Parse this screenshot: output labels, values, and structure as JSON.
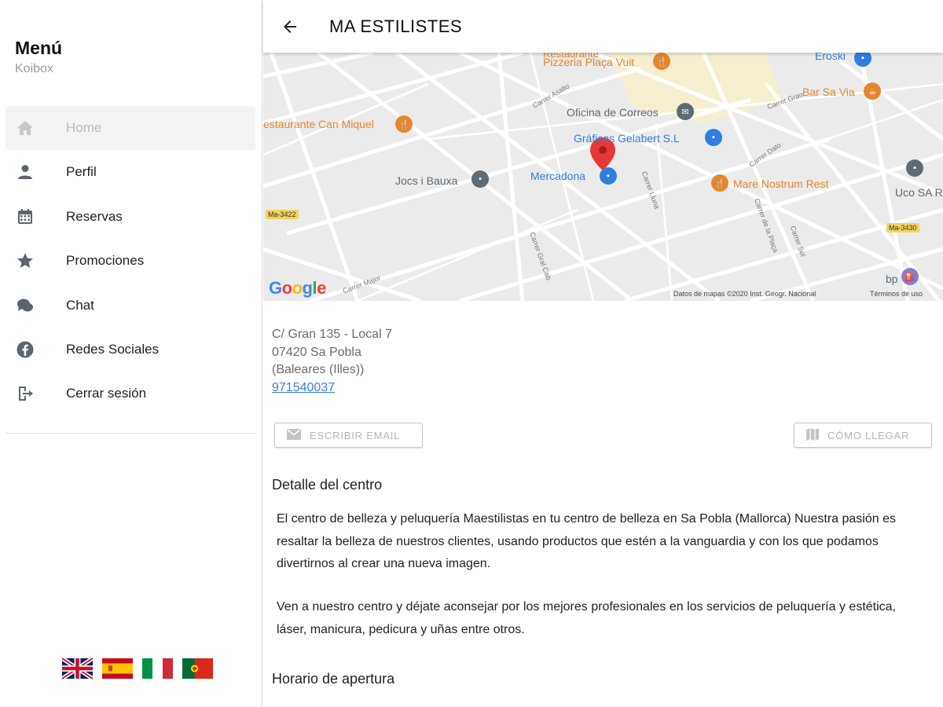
{
  "sidebar": {
    "title": "Menú",
    "subtitle": "Koibox",
    "items": [
      {
        "label": "Home",
        "icon": "home-icon",
        "active": true
      },
      {
        "label": "Perfil",
        "icon": "person-icon"
      },
      {
        "label": "Reservas",
        "icon": "calendar-icon"
      },
      {
        "label": "Promociones",
        "icon": "star-icon"
      },
      {
        "label": "Chat",
        "icon": "chat-icon"
      },
      {
        "label": "Redes Sociales",
        "icon": "facebook-icon"
      },
      {
        "label": "Cerrar sesión",
        "icon": "logout-icon"
      }
    ],
    "flags": [
      "uk-flag-icon",
      "spain-flag-icon",
      "italy-flag-icon",
      "portugal-flag-icon"
    ]
  },
  "header": {
    "title": "MA ESTILISTES"
  },
  "map": {
    "labels": {
      "pizzeria": "Pizzeria Plaça Vuit",
      "restaurante": "Restaurante",
      "eroski": "Eroski",
      "bar": "Bar Sa Via",
      "can_miquel": "estaurante Can Miquel",
      "correos": "Oficina de Correos",
      "graficas": "Gráficas Gelabert S.L",
      "jocs": "Jocs i Bauxa",
      "mercadona": "Mercadona",
      "mare": "Mare Nostrum Rest",
      "uco": "Uco SA R",
      "bp": "bp"
    },
    "road_badges": {
      "left": "Ma-3422",
      "right": "Ma-3430"
    },
    "streets": [
      "Carrer Gran",
      "Carrer Asalto",
      "Carrer Dato",
      "Carrer Major",
      "Carrer Sol",
      "Carrer de la Plaça",
      "Carrer Lluna",
      "Carrer Gral Cab."
    ],
    "google": "Google",
    "attribution": "Datos de mapas ©2020 Inst. Geogr. Nacional",
    "terms": "Términos de uso"
  },
  "address": {
    "line1": "C/ Gran 135 - Local 7",
    "line2": "07420 Sa Pobla",
    "line3": "(Baleares (Illes))",
    "phone": "971540037"
  },
  "buttons": {
    "email": "ESCRIBIR EMAIL",
    "route": "CÓMO LLEGAR"
  },
  "detail": {
    "title": "Detalle del centro",
    "paragraph1": "El centro de belleza y peluquería Maestilistas en tu centro de belleza en Sa Pobla (Mallorca) Nuestra pasión es resaltar la belleza de nuestros clientes, usando productos que estén a la vanguardia y con los que podamos divertirnos al crear una nueva imagen.",
    "paragraph2": "Ven a nuestro centro y déjate aconsejar por los mejores profesionales en los servicios de peluquería y estética, láser, manicura, pedicura y uñas entre otros."
  },
  "hours": {
    "title": "Horario de apertura"
  },
  "colors": {
    "accent": "#e53935",
    "link": "#3b7ddd",
    "poi_orange": "#e5862c",
    "poi_blue": "#2f7de1"
  }
}
